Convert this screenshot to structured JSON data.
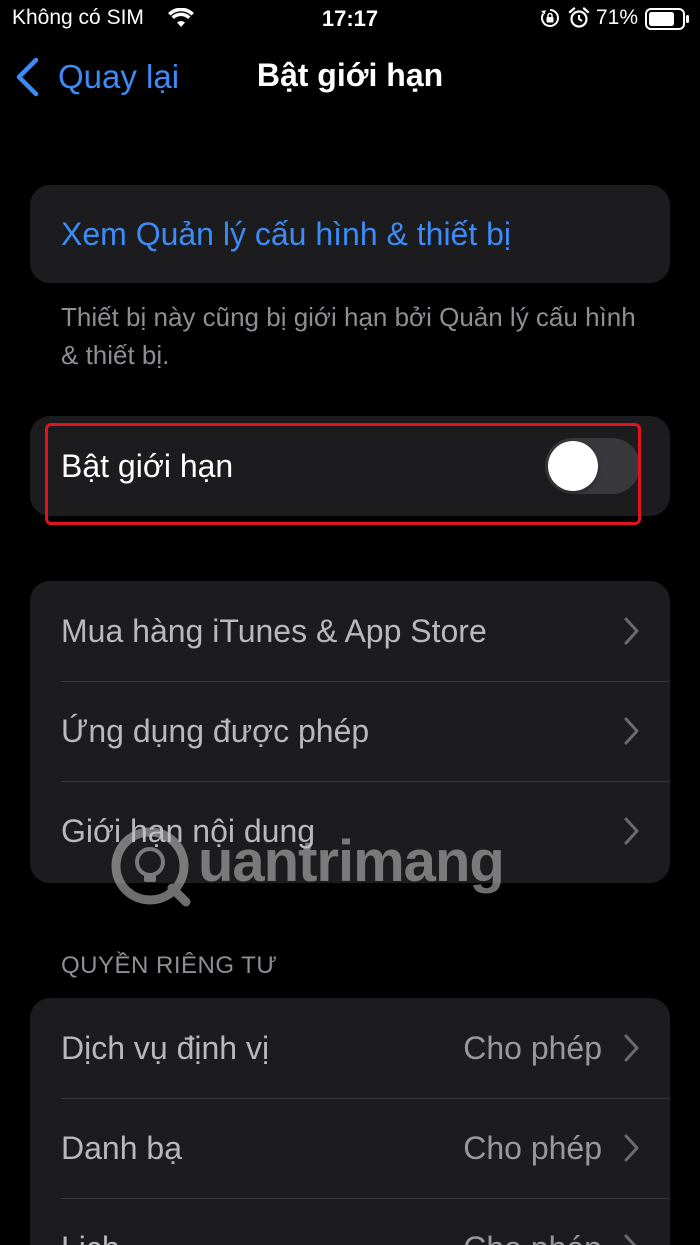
{
  "status_bar": {
    "carrier": "Không có SIM",
    "time": "17:17",
    "battery_percent": "71%",
    "icons": [
      "wifi-icon",
      "lock-rotation-icon",
      "alarm-icon",
      "battery-icon"
    ]
  },
  "nav": {
    "back_label": "Quay lại",
    "title": "Bật giới hạn"
  },
  "profile_link": {
    "label": "Xem Quản lý cấu hình & thiết bị",
    "footnote": "Thiết bị này cũng bị giới hạn bởi Quản lý cấu hình & thiết bị."
  },
  "restrictions_toggle": {
    "label": "Bật giới hạn",
    "enabled": false
  },
  "store_group": {
    "items": [
      {
        "label": "Mua hàng iTunes & App Store"
      },
      {
        "label": "Ứng dụng được phép"
      },
      {
        "label": "Giới hạn nội dung"
      }
    ]
  },
  "privacy": {
    "header": "QUYỀN RIÊNG TƯ",
    "items": [
      {
        "label": "Dịch vụ định vị",
        "value": "Cho phép"
      },
      {
        "label": "Danh bạ",
        "value": "Cho phép"
      },
      {
        "label": "Lịch",
        "value": "Cho phép"
      }
    ]
  },
  "watermark": {
    "text": "uantrimang"
  },
  "colors": {
    "accent": "#3d8bf5",
    "highlight": "#e0141e",
    "background": "#000000",
    "group_background": "#1c1c1e"
  }
}
